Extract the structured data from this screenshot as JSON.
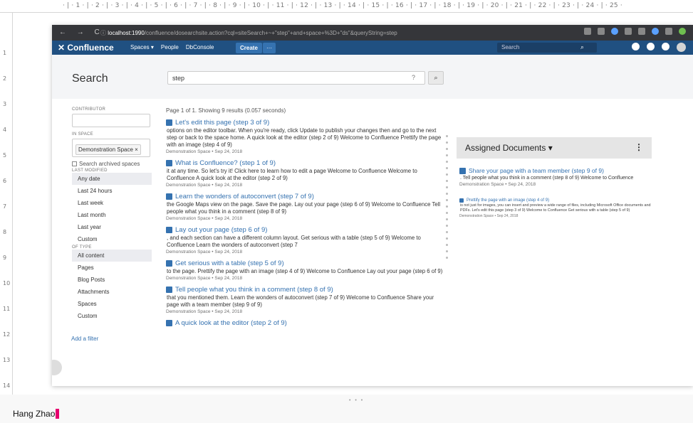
{
  "ruler": {
    "top_ticks": "· | · 1 · | · 2 · | · 3 · | · 4 · | · 5 · | · 6 · | · 7 · | · 8 · | · 9 · | · 10 · | · 11 · | · 12 · | · 13 · | · 14 · | · 15 · | · 16 · | · 17 · | · 18 · | · 19 · | · 20 · | · 21 · | · 22 · | · 23 · | · 24 · | · 25 ·",
    "left": [
      "1",
      "2",
      "3",
      "4",
      "5",
      "6",
      "7",
      "8",
      "9",
      "10",
      "11",
      "12",
      "13",
      "14"
    ]
  },
  "browser": {
    "nav": "← → C",
    "url_host": "localhost:1990",
    "url_path": "/confluence/dosearchsite.action?cql=siteSearch+~+\"step\"+and+space+%3D+\"ds\"&queryString=step"
  },
  "appbar": {
    "logo": "✕ Confluence",
    "nav": [
      "Spaces ▾",
      "People",
      "DbConsole"
    ],
    "create": "Create",
    "more": "···",
    "search_placeholder": "Search",
    "search_icon": "⌕"
  },
  "search": {
    "title": "Search",
    "query": "step",
    "help_icon": "?",
    "go_icon": "⌕"
  },
  "filters": {
    "contributor_label": "CONTRIBUTOR",
    "in_space_label": "IN SPACE",
    "space_chip": "Demonstration Space ×",
    "archived": "Search archived spaces",
    "last_modified_label": "LAST MODIFIED",
    "last_modified": [
      "Any date",
      "Last 24 hours",
      "Last week",
      "Last month",
      "Last year",
      "Custom"
    ],
    "of_type_label": "OF TYPE",
    "of_type": [
      "All content",
      "Pages",
      "Blog Posts",
      "Attachments",
      "Spaces",
      "Custom"
    ],
    "add_filter": "Add a filter"
  },
  "results": {
    "meta": "Page 1 of 1. Showing 9 results (0.057 seconds)",
    "items": [
      {
        "title": "Let's edit this page (step 3 of 9)",
        "snippet": "options on the editor toolbar. When you're ready, click Update to publish your changes then and go to the next step or back to the space home. A quick look at the editor (step 2 of 9) Welcome to Confluence Prettify the page with an image (step 4 of 9)",
        "meta": "Demonstration Space • Sep 24, 2018"
      },
      {
        "title": "What is Confluence? (step 1 of 9)",
        "snippet": "it at any time. So let's try it! Click here to learn how to edit a page Welcome to Confluence Welcome to Confluence A quick look at the editor (step 2 of 9)",
        "meta": "Demonstration Space • Sep 24, 2018"
      },
      {
        "title": "Learn the wonders of autoconvert (step 7 of 9)",
        "snippet": "the Google Maps view on the page. Save the page. Lay out your page (step 6 of 9) Welcome to Confluence Tell people what you think in a comment (step 8 of 9)",
        "meta": "Demonstration Space • Sep 24, 2018"
      },
      {
        "title": "Lay out your page (step 6 of 9)",
        "snippet": ", and each section can have a different column layout. Get serious with a table (step 5 of 9) Welcome to Confluence Learn the wonders of autoconvert (step 7",
        "meta": "Demonstration Space • Sep 24, 2018"
      },
      {
        "title": "Get serious with a table (step 5 of 9)",
        "snippet": "to the page. Prettify the page with an image (step 4 of 9) Welcome to Confluence Lay out your page (step 6 of 9)",
        "meta": "Demonstration Space • Sep 24, 2018"
      },
      {
        "title": "Tell people what you think in a comment (step 8 of 9)",
        "snippet": "that you mentioned them. Learn the wonders of autoconvert (step 7 of 9) Welcome to Confluence Share your page with a team member (step 9 of 9)",
        "meta": "Demonstration Space • Sep 24, 2018"
      },
      {
        "title": "A quick look at the editor (step 2 of 9)",
        "snippet": "",
        "meta": ""
      }
    ]
  },
  "assigned": {
    "title": "Assigned Documents ▾",
    "menu": "⋮",
    "items": [
      {
        "title": "Share your page with a team member (step 9 of 9)",
        "snippet": ". Tell people what you think in a comment (step 8 of 9) Welcome to Confluence",
        "meta": "Demonstration Space • Sep 24, 2018"
      },
      {
        "title": "Prettify the page with an image (step 4 of 9)",
        "snippet": "is not just for images, you can insert and preview a wide range of files, including Microsoft Office documents and PDFs. Let's edit this page (step 3 of 9) Welcome to Confluence Get serious with a table (step 5 of 9)",
        "meta": "Demonstration Space • Sep 24, 2018"
      }
    ]
  },
  "footer": {
    "grip": "• • •",
    "author": "Hang Zhao"
  }
}
